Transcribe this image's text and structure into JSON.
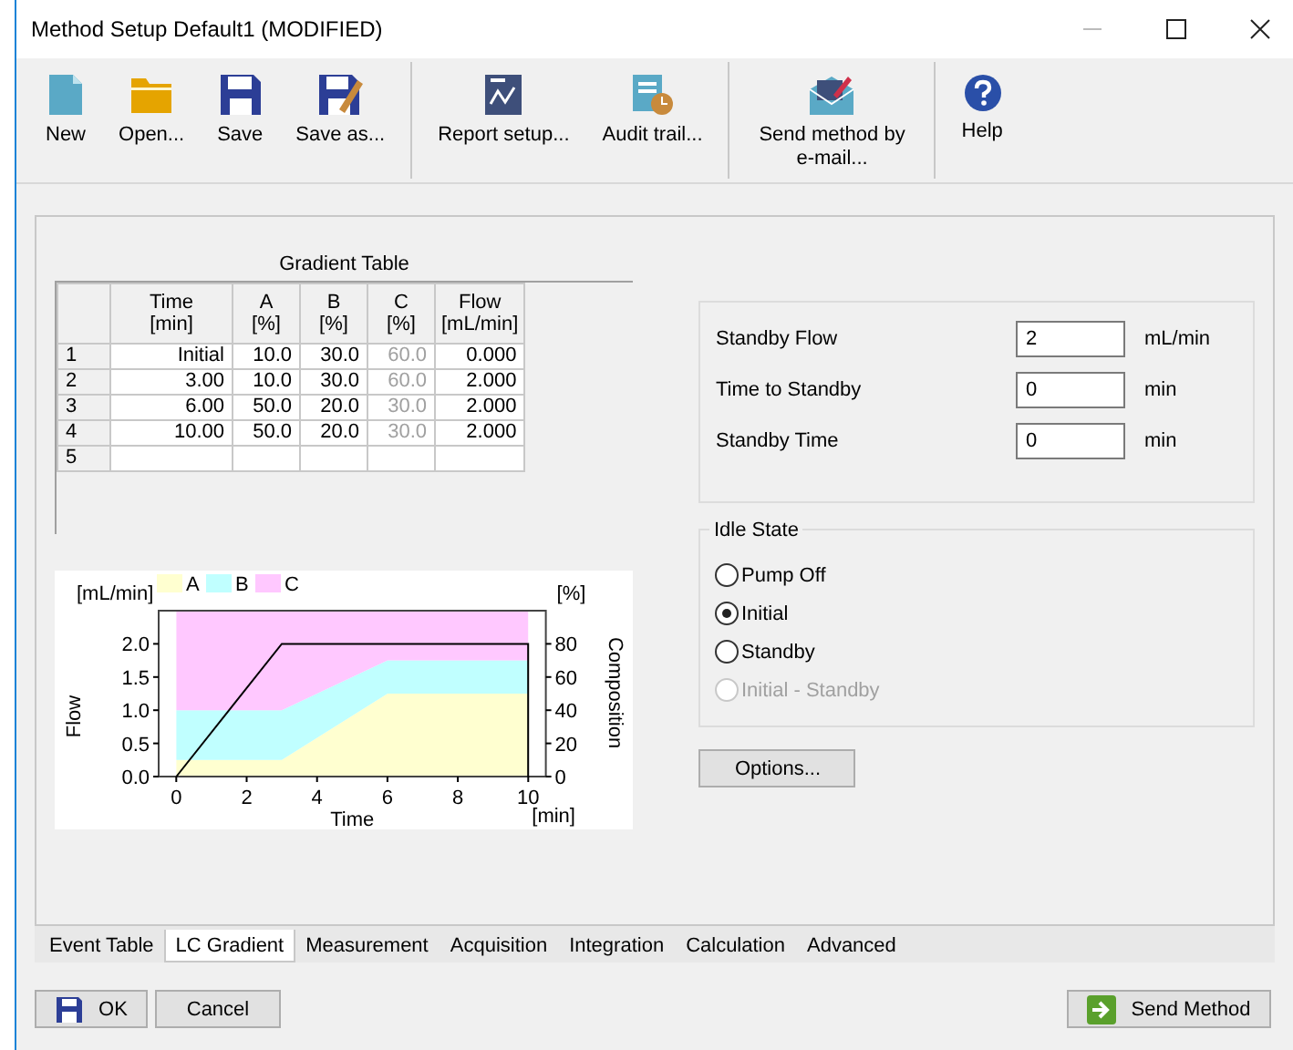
{
  "window": {
    "title": "Method Setup Default1 (MODIFIED)"
  },
  "toolbar": {
    "groups": [
      [
        {
          "label": "New",
          "kind": "new"
        },
        {
          "label": "Open...",
          "kind": "open"
        },
        {
          "label": "Save",
          "kind": "save"
        },
        {
          "label": "Save as...",
          "kind": "saveas"
        }
      ],
      [
        {
          "label": "Report setup...",
          "kind": "report"
        },
        {
          "label": "Audit trail...",
          "kind": "audit"
        }
      ],
      [
        {
          "label": "Send method by e-mail...",
          "kind": "mail"
        }
      ],
      [
        {
          "label": "Help",
          "kind": "help"
        }
      ]
    ]
  },
  "gradient_table": {
    "title": "Gradient Table",
    "columns": [
      {
        "label": "Time",
        "unit": "[min]",
        "dimmed": false
      },
      {
        "label": "A",
        "unit": "[%]",
        "dimmed": false
      },
      {
        "label": "B",
        "unit": "[%]",
        "dimmed": false
      },
      {
        "label": "C",
        "unit": "[%]",
        "dimmed": true
      },
      {
        "label": "Flow",
        "unit": "[mL/min]",
        "dimmed": false
      }
    ],
    "rows": [
      {
        "index": "1",
        "cells": [
          "Initial",
          "10.0",
          "30.0",
          "60.0",
          "0.000"
        ]
      },
      {
        "index": "2",
        "cells": [
          "3.00",
          "10.0",
          "30.0",
          "60.0",
          "2.000"
        ]
      },
      {
        "index": "3",
        "cells": [
          "6.00",
          "50.0",
          "20.0",
          "30.0",
          "2.000"
        ]
      },
      {
        "index": "4",
        "cells": [
          "10.00",
          "50.0",
          "20.0",
          "30.0",
          "2.000"
        ]
      },
      {
        "index": "5",
        "cells": []
      }
    ]
  },
  "gradient_chart": {
    "x_unit": "[min]",
    "y_unit": "[%]",
    "chart_data": {
      "type": "area",
      "stacked": true,
      "legend": "top",
      "ylabel": "Composition",
      "x": [
        0,
        3,
        6,
        10
      ],
      "series": [
        {
          "name": "A",
          "color": "#ffffd0",
          "values": [
            10,
            10,
            50,
            50
          ]
        },
        {
          "name": "B",
          "color": "#c0ffff",
          "values": [
            30,
            30,
            20,
            20
          ]
        },
        {
          "name": "C",
          "color": "#ffc8ff",
          "values": [
            60,
            60,
            30,
            30
          ]
        }
      ],
      "yticks": [
        0,
        20,
        40,
        60,
        80
      ],
      "xlim": [
        -0.5,
        10.5
      ],
      "ylim": [
        0,
        100
      ]
    },
    "flow_unit": "[mL/min]",
    "flow_chart": {
      "chart_data": {
        "type": "line",
        "xlabel": "Time",
        "ylabel": "Flow",
        "x": [
          0,
          3,
          6,
          10,
          10
        ],
        "xticks": [
          0,
          2,
          4,
          6,
          8,
          10
        ],
        "xlim": [
          -0.5,
          10.5
        ],
        "series": [
          {
            "color": "#000000",
            "values": [
              0,
              2,
              2,
              2,
              0
            ]
          }
        ],
        "yticks": [
          {
            "value": 0,
            "label": "0.0"
          },
          {
            "value": 0.5,
            "label": "0.5"
          },
          {
            "value": 1,
            "label": "1.0"
          },
          {
            "value": 1.5,
            "label": "1.5"
          },
          {
            "value": 2,
            "label": "2.0"
          }
        ],
        "ylim": [
          0,
          2.5
        ]
      }
    }
  },
  "standby": {
    "fields": [
      {
        "label": "Standby Flow",
        "value": "2",
        "unit": "mL/min"
      },
      {
        "label": "Time to Standby",
        "value": "0",
        "unit": "min"
      },
      {
        "label": "Standby Time",
        "value": "0",
        "unit": "min"
      }
    ]
  },
  "idle_state": {
    "title": "Idle State",
    "options": [
      {
        "label": "Pump Off",
        "selected": false,
        "disabled": false
      },
      {
        "label": "Initial",
        "selected": true,
        "disabled": false
      },
      {
        "label": "Standby",
        "selected": false,
        "disabled": false
      },
      {
        "label": "Initial - Standby",
        "selected": false,
        "disabled": true
      }
    ]
  },
  "options_button": "Options...",
  "tabs": [
    {
      "label": "Event Table",
      "selected": false
    },
    {
      "label": "LC Gradient",
      "selected": true
    },
    {
      "label": "Measurement",
      "selected": false
    },
    {
      "label": "Acquisition",
      "selected": false
    },
    {
      "label": "Integration",
      "selected": false
    },
    {
      "label": "Calculation",
      "selected": false
    },
    {
      "label": "Advanced",
      "selected": false
    }
  ],
  "buttons": {
    "ok": "OK",
    "cancel": "Cancel",
    "send": "Send Method"
  }
}
